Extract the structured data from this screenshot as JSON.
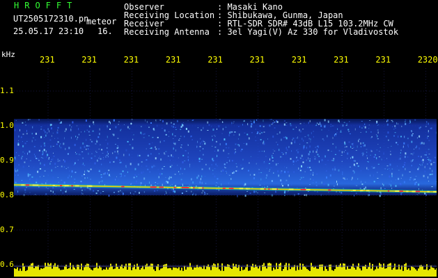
{
  "header": {
    "app_title": "HROFFT",
    "file_name": "UT2505172310.pn",
    "file_suffix": "meteor",
    "date_time": "25.05.17 23:10",
    "frame_no": "16."
  },
  "station": {
    "rows": [
      {
        "label": "Observer",
        "value": ": Masaki Kano"
      },
      {
        "label": "Receiving Location",
        "value": ": Shibukawa, Gunma, Japan"
      },
      {
        "label": "Receiver",
        "value": ": RTL-SDR SDR# 43dB L15 103.2MHz CW"
      },
      {
        "label": "Receiving Antenna",
        "value": ": 3el Yagi(V) Az 330 for Vladivostok"
      }
    ]
  },
  "colors": {
    "background": "#000000",
    "label_text": "#ffffff",
    "title_text": "#33ff33",
    "tick_text": "#ffff00",
    "echo_trace": "#ffcc00",
    "noise_band": "#1a3fd0",
    "grid": "#2b2b7a",
    "baseline": "#ffff00"
  },
  "chart_data": {
    "type": "heatmap",
    "ylabel": "kHz",
    "yticks": [
      "1.1",
      "1.0",
      "0.9",
      "0.8",
      "0.7",
      "0.6"
    ],
    "xticks": [
      "231",
      "231",
      "231",
      "231",
      "231",
      "231",
      "231",
      "231",
      "231",
      "2320"
    ],
    "ylim": [
      0.6,
      1.15
    ],
    "noise_band_khz": [
      0.8,
      1.02
    ],
    "carrier_trace_khz": [
      0.83,
      0.81
    ],
    "grid": true
  }
}
